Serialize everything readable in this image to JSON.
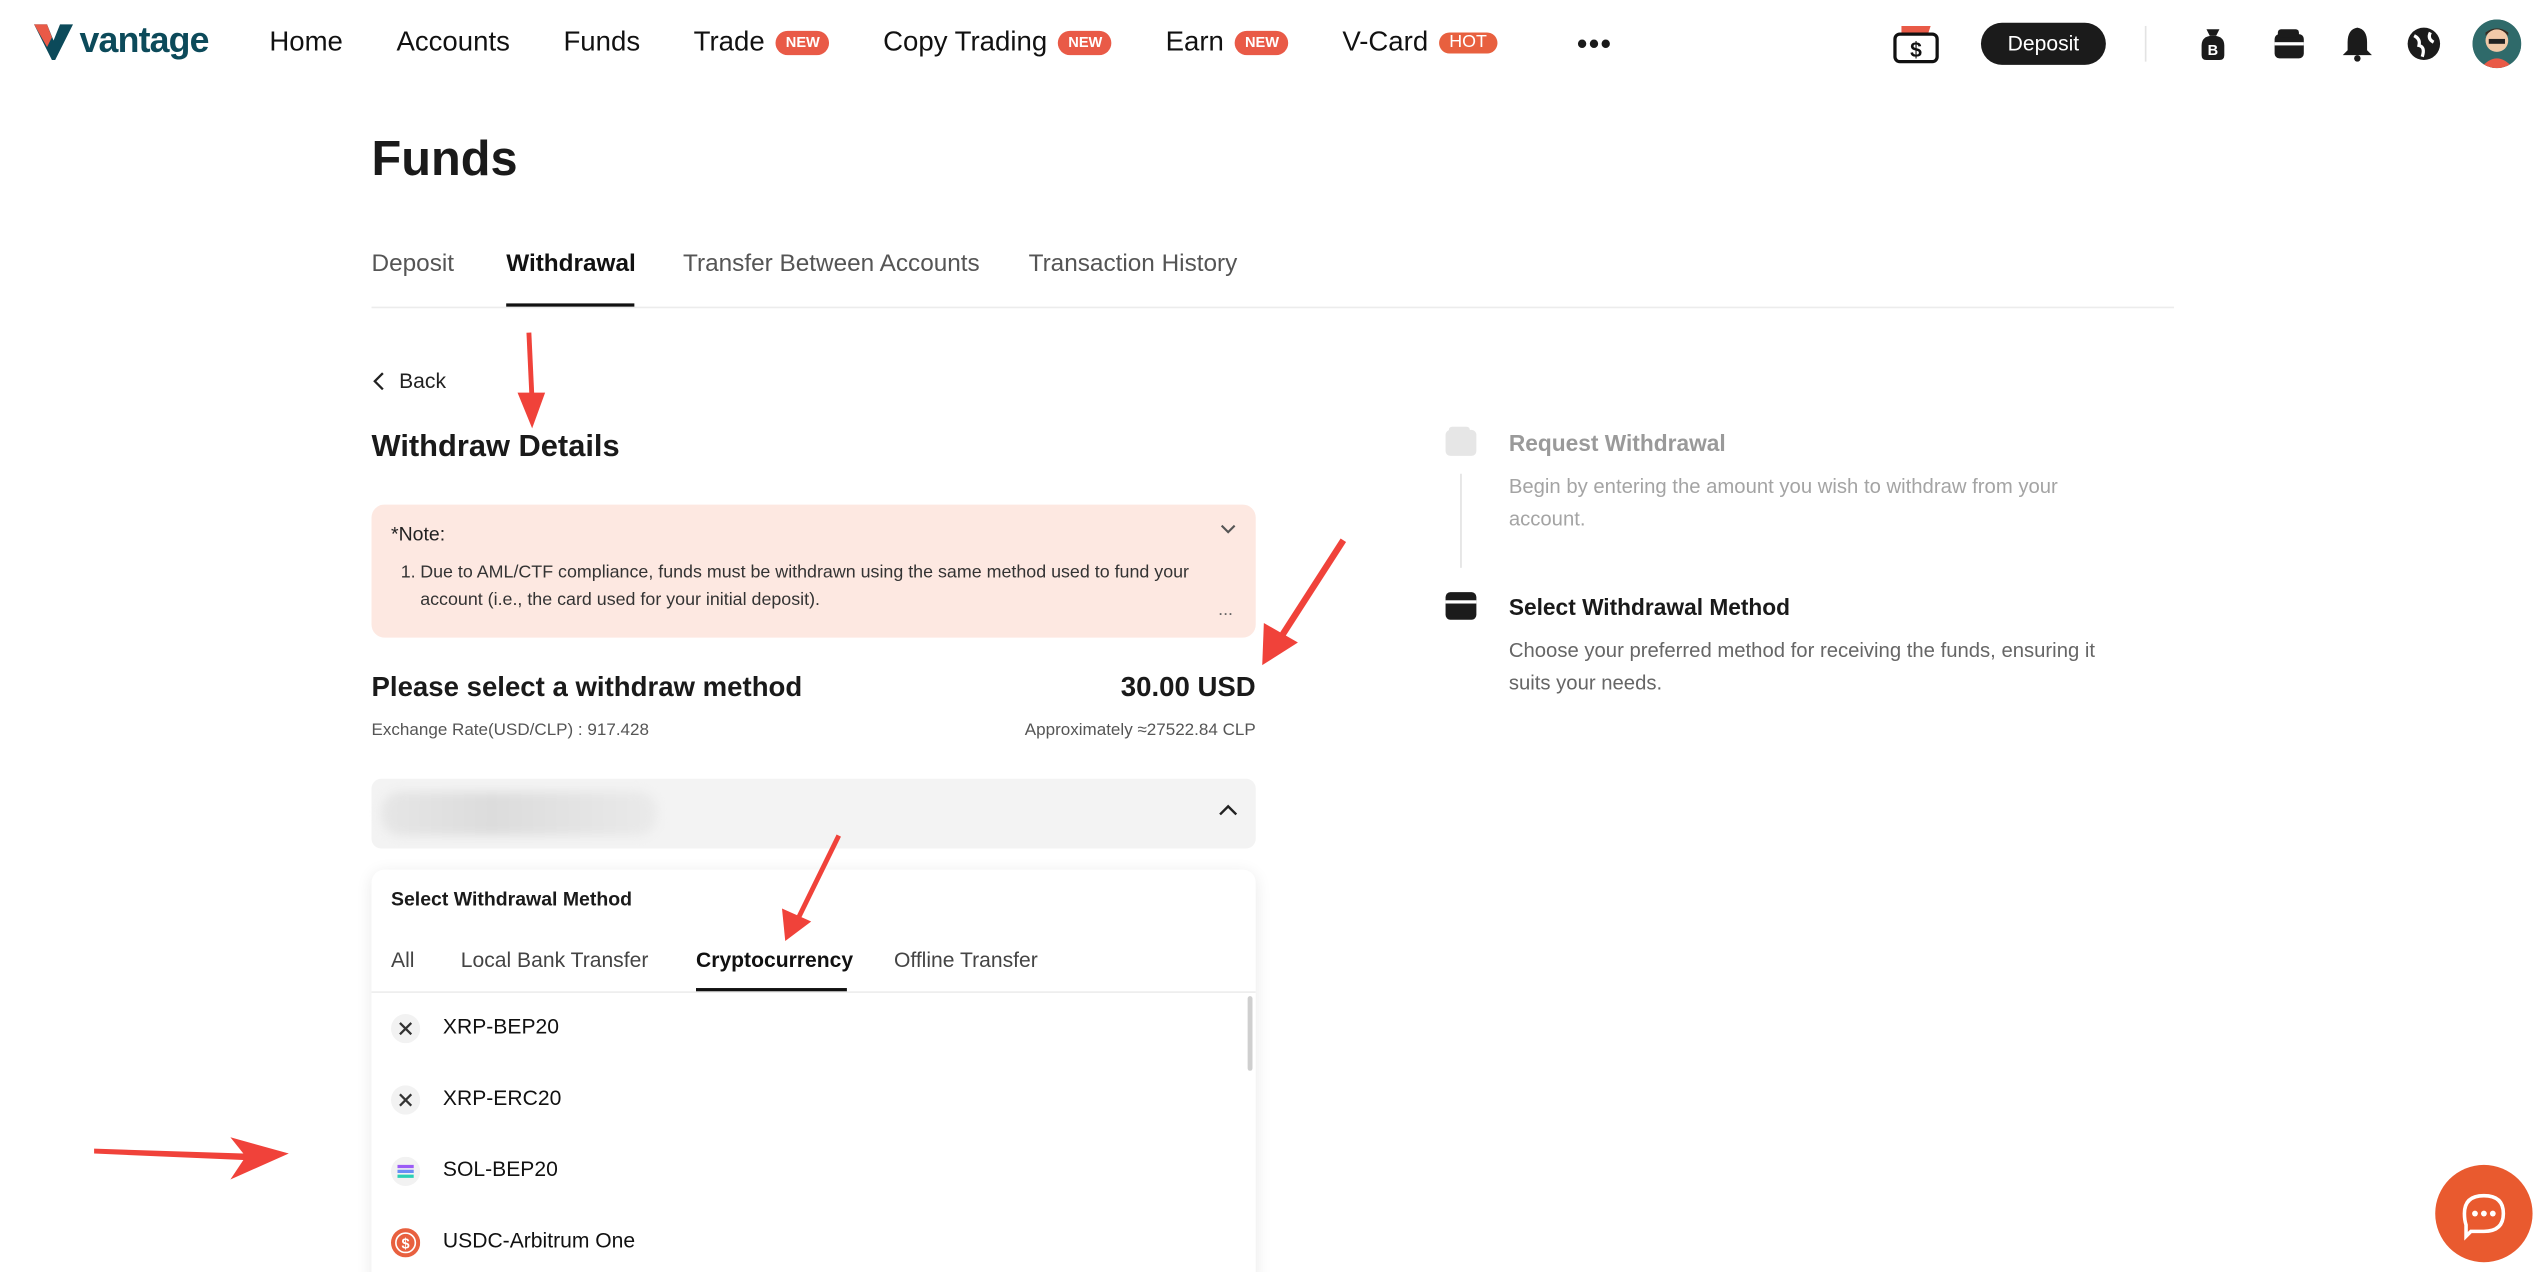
{
  "brand": {
    "name": "vantage",
    "accent": "#e95a47",
    "dark": "#1b1b1b",
    "logo_color": "#0c4a5a"
  },
  "nav": {
    "items": [
      {
        "label": "Home",
        "badge": ""
      },
      {
        "label": "Accounts",
        "badge": ""
      },
      {
        "label": "Funds",
        "badge": ""
      },
      {
        "label": "Trade",
        "badge": "NEW"
      },
      {
        "label": "Copy Trading",
        "badge": "NEW"
      },
      {
        "label": "Earn",
        "badge": "NEW"
      },
      {
        "label": "V-Card",
        "badge": "HOT"
      }
    ],
    "more": "•••",
    "deposit_label": "Deposit",
    "icons": [
      "coupon-dollar-icon",
      "crypto-bag-icon",
      "wallet-icon",
      "bell-icon",
      "globe-icon",
      "user-avatar"
    ]
  },
  "page": {
    "title": "Funds",
    "tabs": [
      "Deposit",
      "Withdrawal",
      "Transfer Between Accounts",
      "Transaction History"
    ],
    "active_tab": "Withdrawal",
    "back_label": "Back",
    "section_title": "Withdraw Details"
  },
  "note": {
    "title": "*Note:",
    "items": [
      {
        "num": "1.",
        "text": "Due to AML/CTF compliance, funds must be withdrawn using the same method used to fund your account (i.e., the card used for your initial deposit)."
      }
    ],
    "more": "..."
  },
  "withdraw": {
    "heading": "Please select a withdraw method",
    "amount": "30.00 USD",
    "rate": "Exchange Rate(USD/CLP) : 917.428",
    "approx": "Approximately ≈27522.84 CLP"
  },
  "dropdown": {
    "title": "Select Withdrawal Method",
    "tabs": [
      "All",
      "Local Bank Transfer",
      "Cryptocurrency",
      "Offline Transfer"
    ],
    "active_tab": "Cryptocurrency",
    "items": [
      {
        "label": "XRP-BEP20",
        "icon": "xrp-icon"
      },
      {
        "label": "XRP-ERC20",
        "icon": "xrp-icon"
      },
      {
        "label": "SOL-BEP20",
        "icon": "solana-icon"
      },
      {
        "label": "USDC-Arbitrum One",
        "icon": "usdc-icon"
      }
    ]
  },
  "steps": [
    {
      "title": "Request Withdrawal",
      "desc": "Begin by entering the amount you wish to withdraw from your account.",
      "state": "done"
    },
    {
      "title": "Select Withdrawal Method",
      "desc": "Choose your preferred method for receiving the funds, ensuring it suits your needs.",
      "state": "current"
    }
  ],
  "annotations": {
    "arrow_color": "#f0423a"
  }
}
